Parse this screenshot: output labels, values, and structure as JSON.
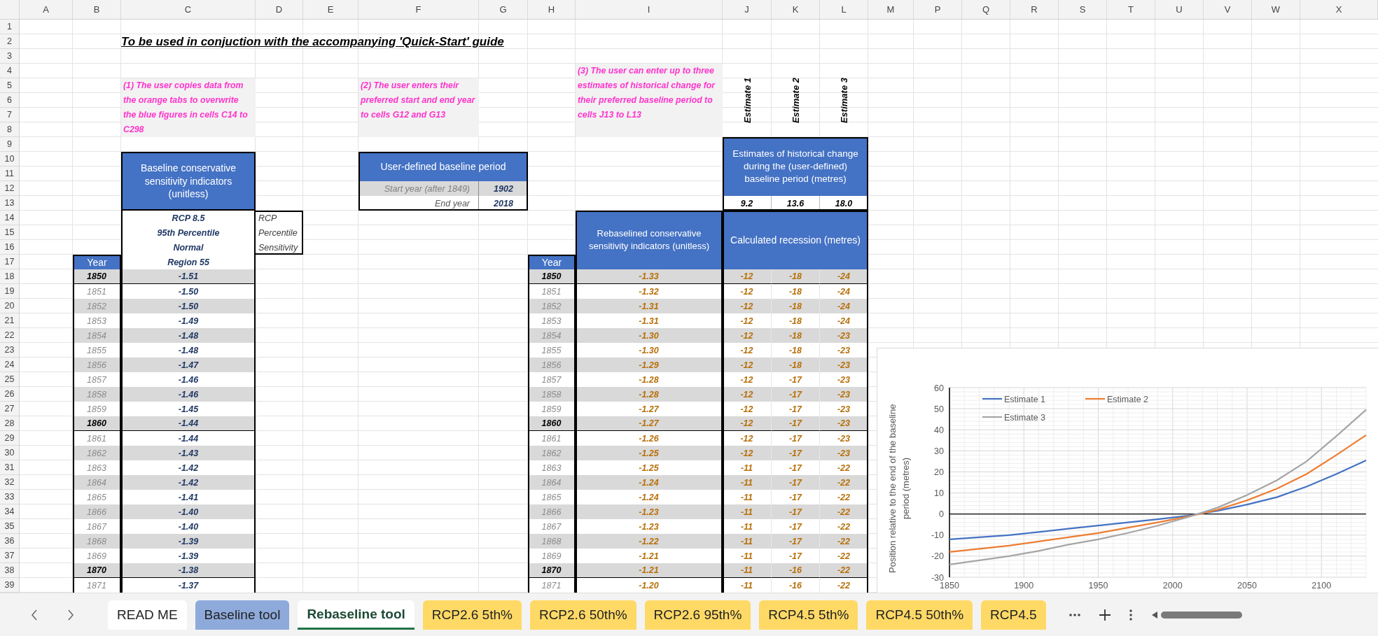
{
  "sheet": {
    "column_headers": [
      "A",
      "B",
      "C",
      "D",
      "E",
      "F",
      "G",
      "H",
      "I",
      "J",
      "K",
      "L",
      "M",
      "P",
      "Q",
      "R",
      "S",
      "T",
      "U",
      "V",
      "W",
      "X"
    ],
    "row_headers": [
      "1",
      "2",
      "3",
      "4",
      "5",
      "6",
      "7",
      "8",
      "9",
      "10",
      "11",
      "12",
      "13",
      "14",
      "15",
      "16",
      "17",
      "18",
      "19",
      "20",
      "21",
      "22",
      "23",
      "24",
      "25",
      "26",
      "27",
      "28",
      "29",
      "30",
      "31",
      "32",
      "33",
      "34",
      "35",
      "36",
      "37",
      "38",
      "39"
    ]
  },
  "title": "To be used in conjuction with the accompanying 'Quick-Start' guide",
  "instructions": [
    "(1) The user copies data from the orange tabs to overwrite the blue figures in cells C14 to C298",
    "(2) The user enters their preferred start and end year to cells G12 and G13",
    "(3) The user can enter up to three estimates of historical change for their preferred baseline period to cells J13 to L13"
  ],
  "estimate_labels": [
    "Estimate 1",
    "Estimate 2",
    "Estimate 3"
  ],
  "estimates_box": {
    "title": "Estimates of historical change during the (user-defined) baseline period (metres)",
    "values": [
      "9.2",
      "13.6",
      "18.0"
    ]
  },
  "baseline": {
    "title": "Baseline conservative sensitivity indicators (unitless)",
    "settings": [
      {
        "value": "RCP 8.5",
        "label": "RCP"
      },
      {
        "value": "95th Percentile",
        "label": "Percentile"
      },
      {
        "value": "Normal",
        "label": "Sensitivity"
      }
    ],
    "region": "Region 55",
    "year_header": "Year"
  },
  "baseline_period": {
    "title": "User-defined baseline period",
    "rows": [
      {
        "label": "Start year (after 1849)",
        "value": "1902",
        "highlighted": true
      },
      {
        "label": "End year",
        "value": "2018",
        "highlighted": false
      }
    ]
  },
  "rebaselined": {
    "year_header": "Year",
    "title": "Rebaselined conservative sensitivity indicators (unitless)",
    "recession_title": "Calculated recession (metres)"
  },
  "rows": [
    {
      "year": "1850",
      "rebaselined_year": "1850",
      "bold": true,
      "baseline": "-1.51",
      "rebaselined": "-1.33",
      "recession": [
        "-12",
        "-18",
        "-24"
      ]
    },
    {
      "year": "1851",
      "rebaselined_year": "1851",
      "bold": false,
      "baseline": "-1.50",
      "rebaselined": "-1.32",
      "recession": [
        "-12",
        "-18",
        "-24"
      ]
    },
    {
      "year": "1852",
      "rebaselined_year": "1852",
      "bold": false,
      "baseline": "-1.50",
      "rebaselined": "-1.31",
      "recession": [
        "-12",
        "-18",
        "-24"
      ]
    },
    {
      "year": "1853",
      "rebaselined_year": "1853",
      "bold": false,
      "baseline": "-1.49",
      "rebaselined": "-1.31",
      "recession": [
        "-12",
        "-18",
        "-24"
      ]
    },
    {
      "year": "1854",
      "rebaselined_year": "1854",
      "bold": false,
      "baseline": "-1.48",
      "rebaselined": "-1.30",
      "recession": [
        "-12",
        "-18",
        "-23"
      ]
    },
    {
      "year": "1855",
      "rebaselined_year": "1855",
      "bold": false,
      "baseline": "-1.48",
      "rebaselined": "-1.30",
      "recession": [
        "-12",
        "-18",
        "-23"
      ]
    },
    {
      "year": "1856",
      "rebaselined_year": "1856",
      "bold": false,
      "baseline": "-1.47",
      "rebaselined": "-1.29",
      "recession": [
        "-12",
        "-18",
        "-23"
      ]
    },
    {
      "year": "1857",
      "rebaselined_year": "1857",
      "bold": false,
      "baseline": "-1.46",
      "rebaselined": "-1.28",
      "recession": [
        "-12",
        "-17",
        "-23"
      ]
    },
    {
      "year": "1858",
      "rebaselined_year": "1858",
      "bold": false,
      "baseline": "-1.46",
      "rebaselined": "-1.28",
      "recession": [
        "-12",
        "-17",
        "-23"
      ]
    },
    {
      "year": "1859",
      "rebaselined_year": "1859",
      "bold": false,
      "baseline": "-1.45",
      "rebaselined": "-1.27",
      "recession": [
        "-12",
        "-17",
        "-23"
      ]
    },
    {
      "year": "1860",
      "rebaselined_year": "1860",
      "bold": true,
      "baseline": "-1.44",
      "rebaselined": "-1.27",
      "recession": [
        "-12",
        "-17",
        "-23"
      ]
    },
    {
      "year": "1861",
      "rebaselined_year": "1861",
      "bold": false,
      "baseline": "-1.44",
      "rebaselined": "-1.26",
      "recession": [
        "-12",
        "-17",
        "-23"
      ]
    },
    {
      "year": "1862",
      "rebaselined_year": "1862",
      "bold": false,
      "baseline": "-1.43",
      "rebaselined": "-1.25",
      "recession": [
        "-12",
        "-17",
        "-23"
      ]
    },
    {
      "year": "1863",
      "rebaselined_year": "1863",
      "bold": false,
      "baseline": "-1.42",
      "rebaselined": "-1.25",
      "recession": [
        "-11",
        "-17",
        "-22"
      ]
    },
    {
      "year": "1864",
      "rebaselined_year": "1864",
      "bold": false,
      "baseline": "-1.42",
      "rebaselined": "-1.24",
      "recession": [
        "-11",
        "-17",
        "-22"
      ]
    },
    {
      "year": "1865",
      "rebaselined_year": "1865",
      "bold": false,
      "baseline": "-1.41",
      "rebaselined": "-1.24",
      "recession": [
        "-11",
        "-17",
        "-22"
      ]
    },
    {
      "year": "1866",
      "rebaselined_year": "1866",
      "bold": false,
      "baseline": "-1.40",
      "rebaselined": "-1.23",
      "recession": [
        "-11",
        "-17",
        "-22"
      ]
    },
    {
      "year": "1867",
      "rebaselined_year": "1867",
      "bold": false,
      "baseline": "-1.40",
      "rebaselined": "-1.23",
      "recession": [
        "-11",
        "-17",
        "-22"
      ]
    },
    {
      "year": "1868",
      "rebaselined_year": "1868",
      "bold": false,
      "baseline": "-1.39",
      "rebaselined": "-1.22",
      "recession": [
        "-11",
        "-17",
        "-22"
      ]
    },
    {
      "year": "1869",
      "rebaselined_year": "1869",
      "bold": false,
      "baseline": "-1.39",
      "rebaselined": "-1.21",
      "recession": [
        "-11",
        "-17",
        "-22"
      ]
    },
    {
      "year": "1870",
      "rebaselined_year": "1870",
      "bold": true,
      "baseline": "-1.38",
      "rebaselined": "-1.21",
      "recession": [
        "-11",
        "-16",
        "-22"
      ]
    },
    {
      "year": "1871",
      "rebaselined_year": "1871",
      "bold": false,
      "baseline": "-1.37",
      "rebaselined": "-1.20",
      "recession": [
        "-11",
        "-16",
        "-22"
      ]
    }
  ],
  "chart": {
    "chart_data": {
      "type": "line",
      "ylabel": "Position relative to the end of the baseline period (metres)",
      "x": [
        1850,
        1870,
        1890,
        1910,
        1930,
        1950,
        1970,
        1990,
        2010,
        2030,
        2050,
        2070,
        2090,
        2110,
        2130
      ],
      "series": [
        {
          "name": "Estimate 1",
          "color": "#4472c4",
          "values": [
            -12,
            -11,
            -10,
            -8.5,
            -7,
            -5.5,
            -4,
            -2.5,
            -0.8,
            1.5,
            4.5,
            8,
            13,
            19,
            25.5
          ]
        },
        {
          "name": "Estimate 2",
          "color": "#ed7d31",
          "values": [
            -18,
            -16.5,
            -15,
            -13,
            -11,
            -9,
            -6.5,
            -4,
            -1.2,
            2,
            6.5,
            12,
            19,
            28,
            37.5
          ]
        },
        {
          "name": "Estimate 3",
          "color": "#a5a5a5",
          "values": [
            -24,
            -22,
            -20,
            -17.5,
            -14.5,
            -12,
            -9,
            -5.5,
            -1.5,
            3,
            9,
            16,
            25,
            37,
            49.5
          ]
        }
      ],
      "grid": true,
      "legend": true,
      "xlim": [
        1850,
        2130
      ],
      "ylim": [
        -30,
        60
      ],
      "xticks": [
        1850,
        1900,
        1950,
        2000,
        2050,
        2100
      ],
      "yticks": [
        -30,
        -20,
        -10,
        0,
        10,
        20,
        30,
        40,
        50,
        60
      ]
    }
  },
  "tabs": [
    {
      "label": "READ ME",
      "color": "#ffffff",
      "selected": false
    },
    {
      "label": "Baseline tool",
      "color": "#8eaadb",
      "selected": false
    },
    {
      "label": "Rebaseline tool",
      "color": "#ffffff",
      "selected": true
    },
    {
      "label": "RCP2.6 5th%",
      "color": "#ffd966",
      "selected": false
    },
    {
      "label": "RCP2.6 50th%",
      "color": "#ffd966",
      "selected": false
    },
    {
      "label": "RCP2.6 95th%",
      "color": "#ffd966",
      "selected": false
    },
    {
      "label": "RCP4.5 5th%",
      "color": "#ffd966",
      "selected": false
    },
    {
      "label": "RCP4.5 50th%",
      "color": "#ffd966",
      "selected": false
    },
    {
      "label": "RCP4.5",
      "color": "#ffd966",
      "selected": false
    }
  ]
}
